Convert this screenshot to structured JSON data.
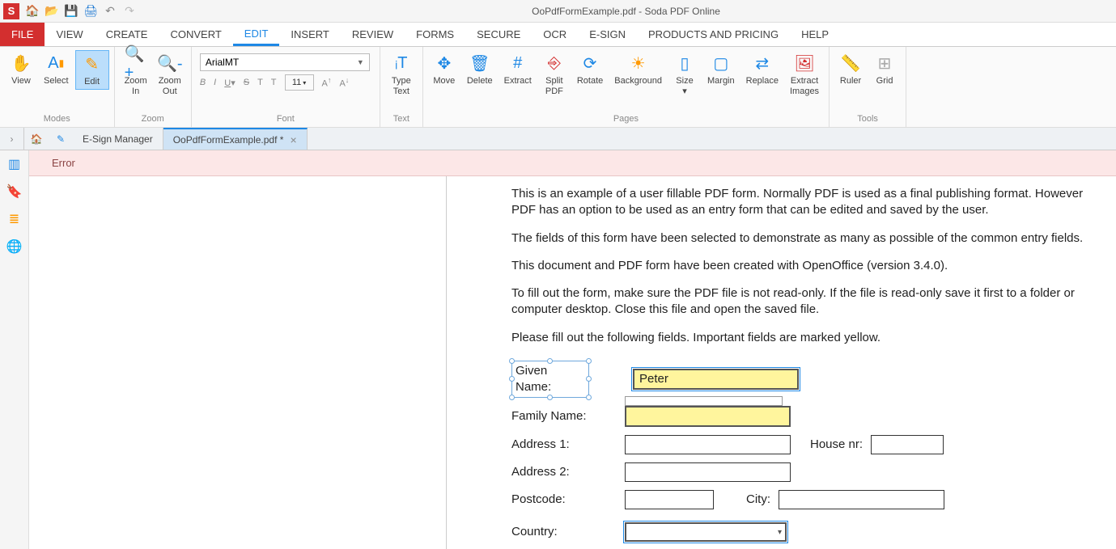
{
  "titlebar": {
    "title": "OoPdfFormExample.pdf - Soda PDF Online",
    "logo": "S"
  },
  "menu": {
    "file": "FILE",
    "view": "VIEW",
    "create": "CREATE",
    "convert": "CONVERT",
    "edit": "EDIT",
    "insert": "INSERT",
    "review": "REVIEW",
    "forms": "FORMS",
    "secure": "SECURE",
    "ocr": "OCR",
    "esign": "E-SIGN",
    "products": "PRODUCTS AND PRICING",
    "help": "HELP"
  },
  "ribbon": {
    "modes": {
      "label": "Modes",
      "view": "View",
      "select": "Select",
      "edit": "Edit"
    },
    "zoom": {
      "label": "Zoom",
      "in": "Zoom\nIn",
      "out": "Zoom\nOut"
    },
    "font": {
      "label": "Font",
      "name": "ArialMT",
      "size": "11"
    },
    "text": {
      "label": "Text",
      "type": "Type\nText"
    },
    "pages": {
      "label": "Pages",
      "move": "Move",
      "delete": "Delete",
      "extract": "Extract",
      "split": "Split\nPDF",
      "rotate": "Rotate",
      "background": "Background",
      "size": "Size",
      "margin": "Margin",
      "replace": "Replace",
      "extractimg": "Extract\nImages"
    },
    "tools": {
      "label": "Tools",
      "ruler": "Ruler",
      "grid": "Grid"
    }
  },
  "tabs": {
    "esign": "E-Sign Manager",
    "doc": "OoPdfFormExample.pdf *"
  },
  "error": "Error",
  "doc": {
    "p1": "This is an example of a user fillable PDF form. Normally PDF is used as a final publishing format. However PDF has an option to be used as an entry form that can be edited and saved by the user.",
    "p2": "The fields of this form have been selected to demonstrate as many as possible of the common entry fields.",
    "p3": "This document and PDF form have been created with OpenOffice (version 3.4.0).",
    "p4": "To fill out the form, make sure the PDF file is not read-only. If the file is read-only save it first to a folder or computer desktop. Close this file and open the saved file.",
    "p5": "Please fill out the following fields. Important fields are marked yellow.",
    "given_label": "Given Name:",
    "family_label": "Family Name:",
    "addr1_label": "Address 1:",
    "addr2_label": "Address 2:",
    "postcode_label": "Postcode:",
    "house_label": "House nr:",
    "city_label": "City:",
    "country_label": "Country:",
    "given_value": "Peter",
    "family_value": ""
  }
}
